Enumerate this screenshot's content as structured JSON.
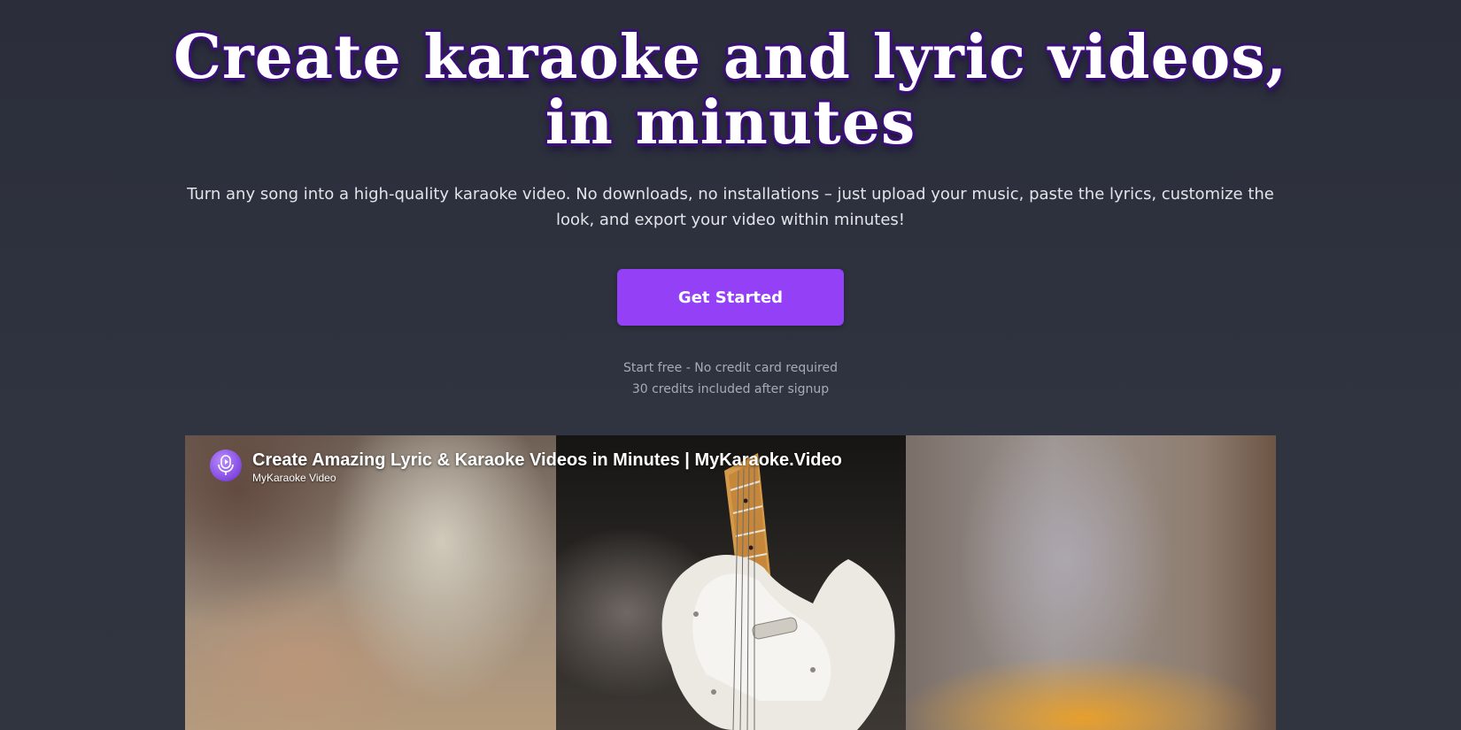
{
  "hero": {
    "headline_line1": "Create karaoke and lyric videos,",
    "headline_line2": "in minutes",
    "subtitle": "Turn any song into a high-quality karaoke video. No downloads, no installations – just upload your music, paste the lyrics, customize the look, and export your video within minutes!",
    "cta_label": "Get Started",
    "note_line1": "Start free - No credit card required",
    "note_line2": "30 credits included after signup"
  },
  "video": {
    "title": "Create Amazing Lyric & Karaoke Videos in Minutes | MyKaraoke.Video",
    "channel": "MyKaraoke Video"
  },
  "colors": {
    "background": "#2d313d",
    "accent": "#9440f6",
    "headline_outline": "#3b0f78"
  },
  "icons": {
    "channel_avatar": "microphone-play-icon"
  }
}
